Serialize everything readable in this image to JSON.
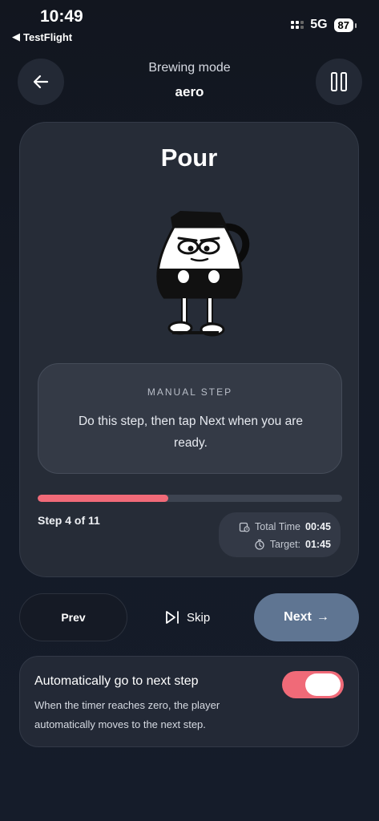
{
  "status_bar": {
    "time": "10:49",
    "back_app": "TestFlight",
    "network": "5G",
    "battery": "87"
  },
  "header": {
    "title": "Brewing mode",
    "subtitle": "aero"
  },
  "step": {
    "title": "Pour",
    "info_label": "MANUAL STEP",
    "info_text": "Do this step, then tap Next when you are ready.",
    "progress": 0.43,
    "step_label": "Step 4 of 11",
    "total_time_label": "Total Time",
    "total_time_value": "00:45",
    "target_label": "Target:",
    "target_value": "01:45"
  },
  "controls": {
    "prev_label": "Prev",
    "skip_label": "Skip",
    "next_label": "Next"
  },
  "auto_next": {
    "title": "Automatically go to next step",
    "description": "When the timer reaches zero, the player automatically moves to the next step.",
    "enabled": true
  },
  "colors": {
    "accent": "#f06a78",
    "next_button": "#5f7592",
    "background": "#141a26"
  },
  "icons": [
    "back-arrow-icon",
    "pause-icon",
    "timer-icon",
    "stopwatch-icon",
    "skip-icon",
    "arrow-right-icon"
  ]
}
